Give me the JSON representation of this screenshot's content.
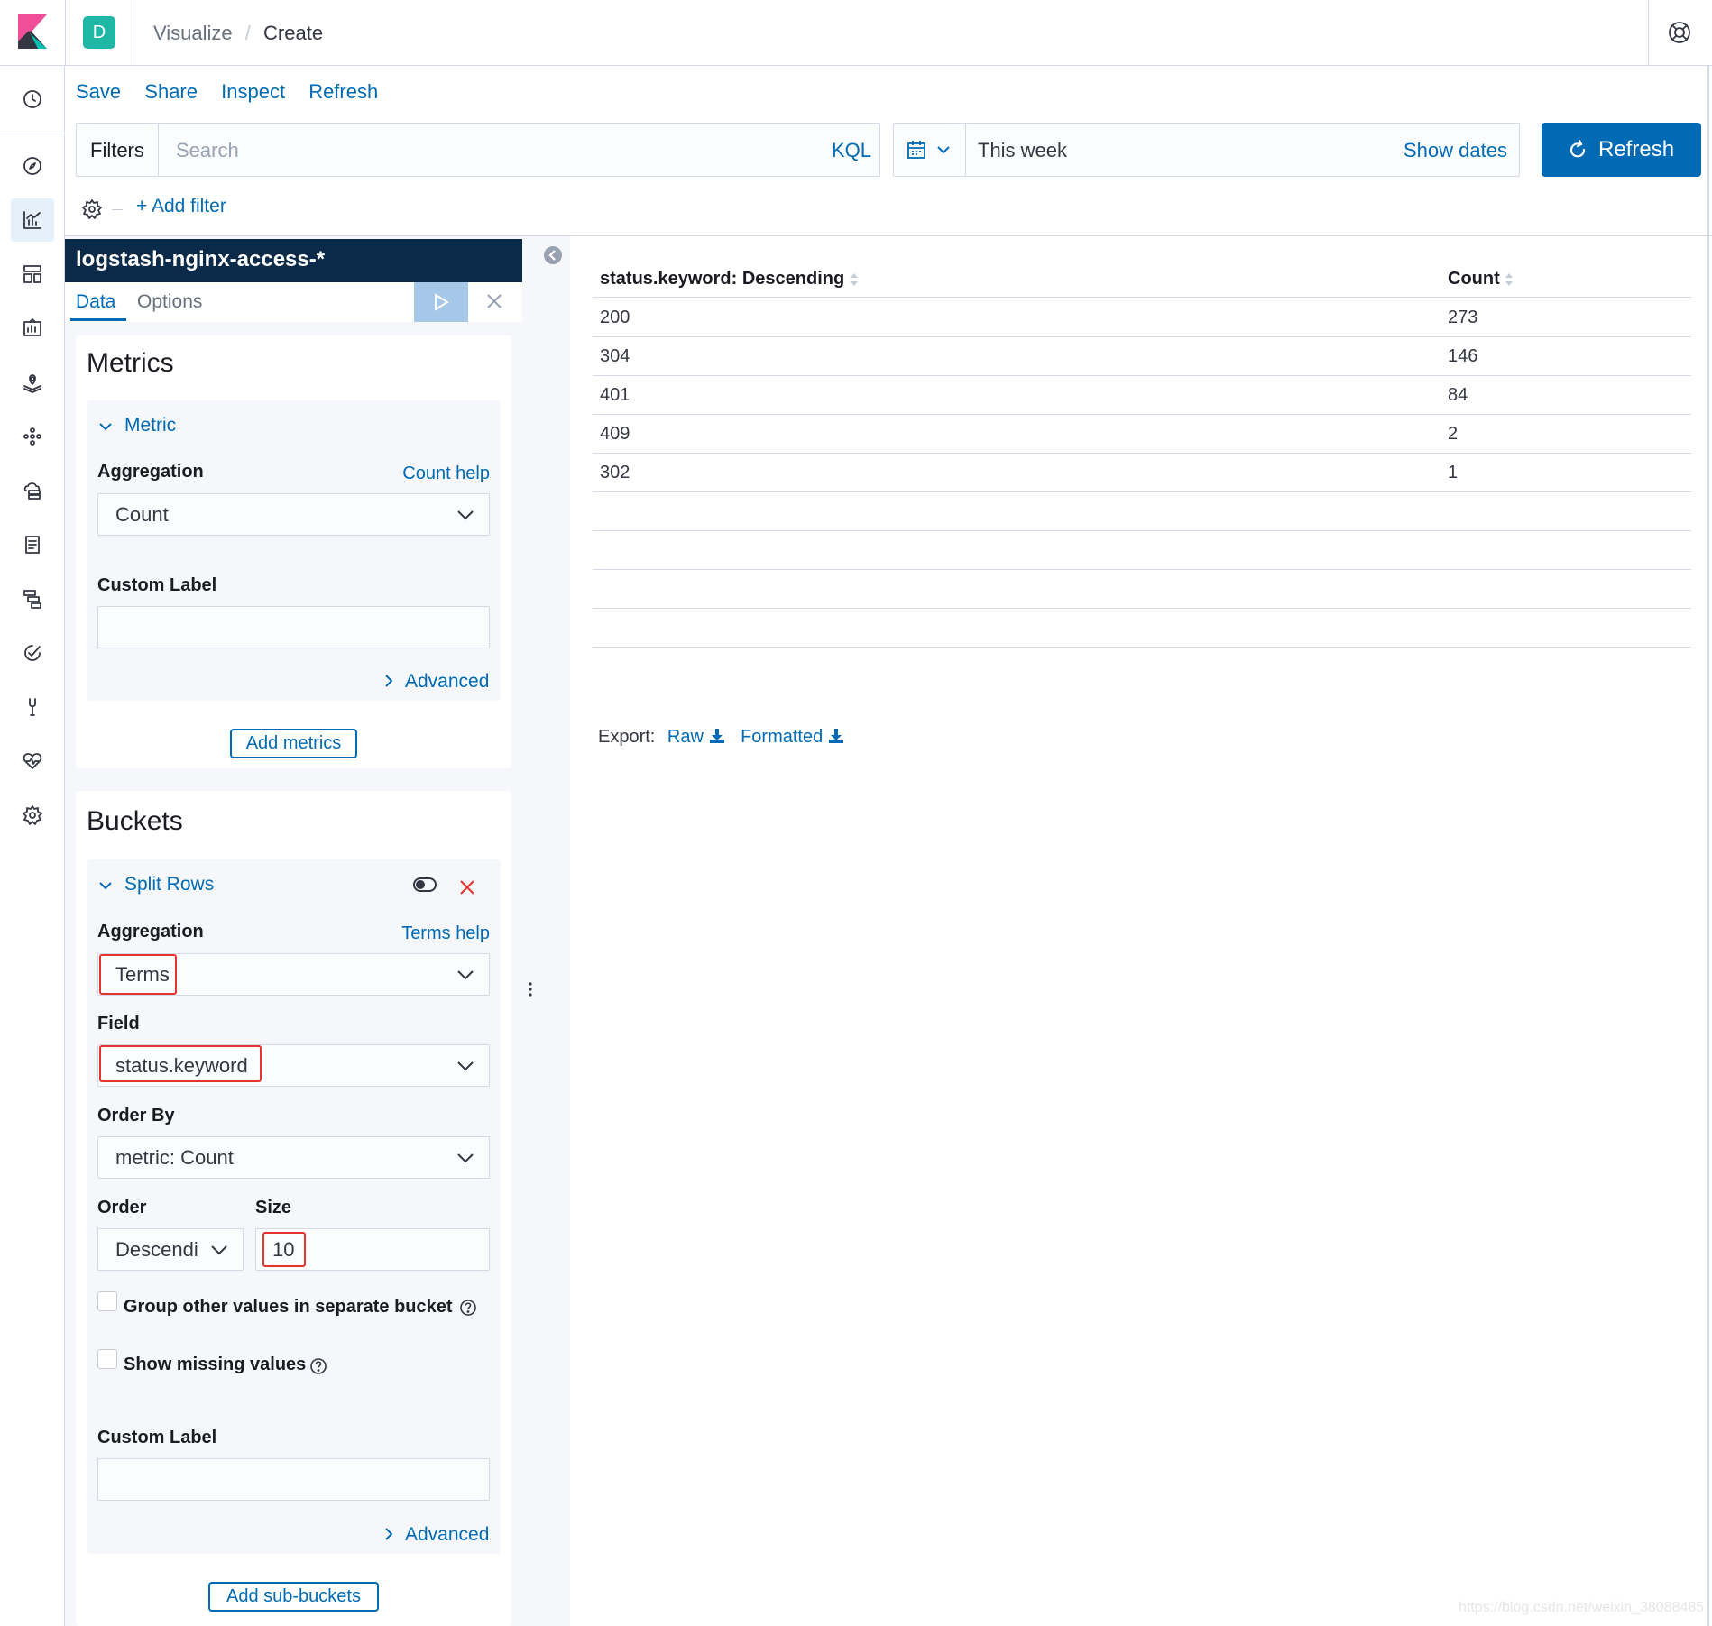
{
  "header": {
    "logo_icon": "kibana-logo-icon",
    "space_initial": "D",
    "space_color": "#20b6a6",
    "breadcrumbs": [
      "Visualize",
      "Create"
    ],
    "help_icon": "help-lifebuoy-icon"
  },
  "topnav": {
    "links": [
      "Save",
      "Share",
      "Inspect",
      "Refresh"
    ]
  },
  "querybar": {
    "filters_label": "Filters",
    "search_placeholder": "Search",
    "kql_label": "KQL",
    "time_range": "This week",
    "show_dates": "Show dates",
    "refresh_button": "Refresh",
    "add_filter": "+ Add filter"
  },
  "sidenav": {
    "items": [
      "clock-icon",
      "compass-icon",
      "visualize-icon",
      "dashboard-icon",
      "canvas-icon",
      "maps-icon",
      "ml-icon",
      "infra-icon",
      "logs-icon",
      "apm-icon",
      "uptime-icon",
      "devtools-icon",
      "monitoring-icon",
      "settings-icon"
    ]
  },
  "editor": {
    "index_pattern": "logstash-nginx-access-*",
    "tabs": [
      "Data",
      "Options"
    ],
    "metrics": {
      "title": "Metrics",
      "section": "Metric",
      "aggregation_label": "Aggregation",
      "help_link": "Count help",
      "aggregation_value": "Count",
      "custom_label": "Custom Label",
      "custom_value": "",
      "advanced": "Advanced",
      "add_button": "Add metrics"
    },
    "buckets": {
      "title": "Buckets",
      "section": "Split Rows",
      "aggregation_label": "Aggregation",
      "help_link": "Terms help",
      "aggregation_value": "Terms",
      "field_label": "Field",
      "field_value": "status.keyword",
      "orderby_label": "Order By",
      "orderby_value": "metric: Count",
      "order_label": "Order",
      "order_value": "Descendi",
      "size_label": "Size",
      "size_value": "10",
      "group_other": "Group other values in separate bucket",
      "show_missing": "Show missing values",
      "custom_label": "Custom Label",
      "custom_value": "",
      "advanced": "Advanced",
      "add_button": "Add sub-buckets"
    }
  },
  "table": {
    "columns": [
      "status.keyword: Descending",
      "Count"
    ],
    "rows": [
      [
        "200",
        "273"
      ],
      [
        "304",
        "146"
      ],
      [
        "401",
        "84"
      ],
      [
        "409",
        "2"
      ],
      [
        "302",
        "1"
      ]
    ],
    "export_label": "Export:",
    "export_raw": "Raw",
    "export_formatted": "Formatted"
  },
  "watermark": "https://blog.csdn.net/weixin_38088485"
}
